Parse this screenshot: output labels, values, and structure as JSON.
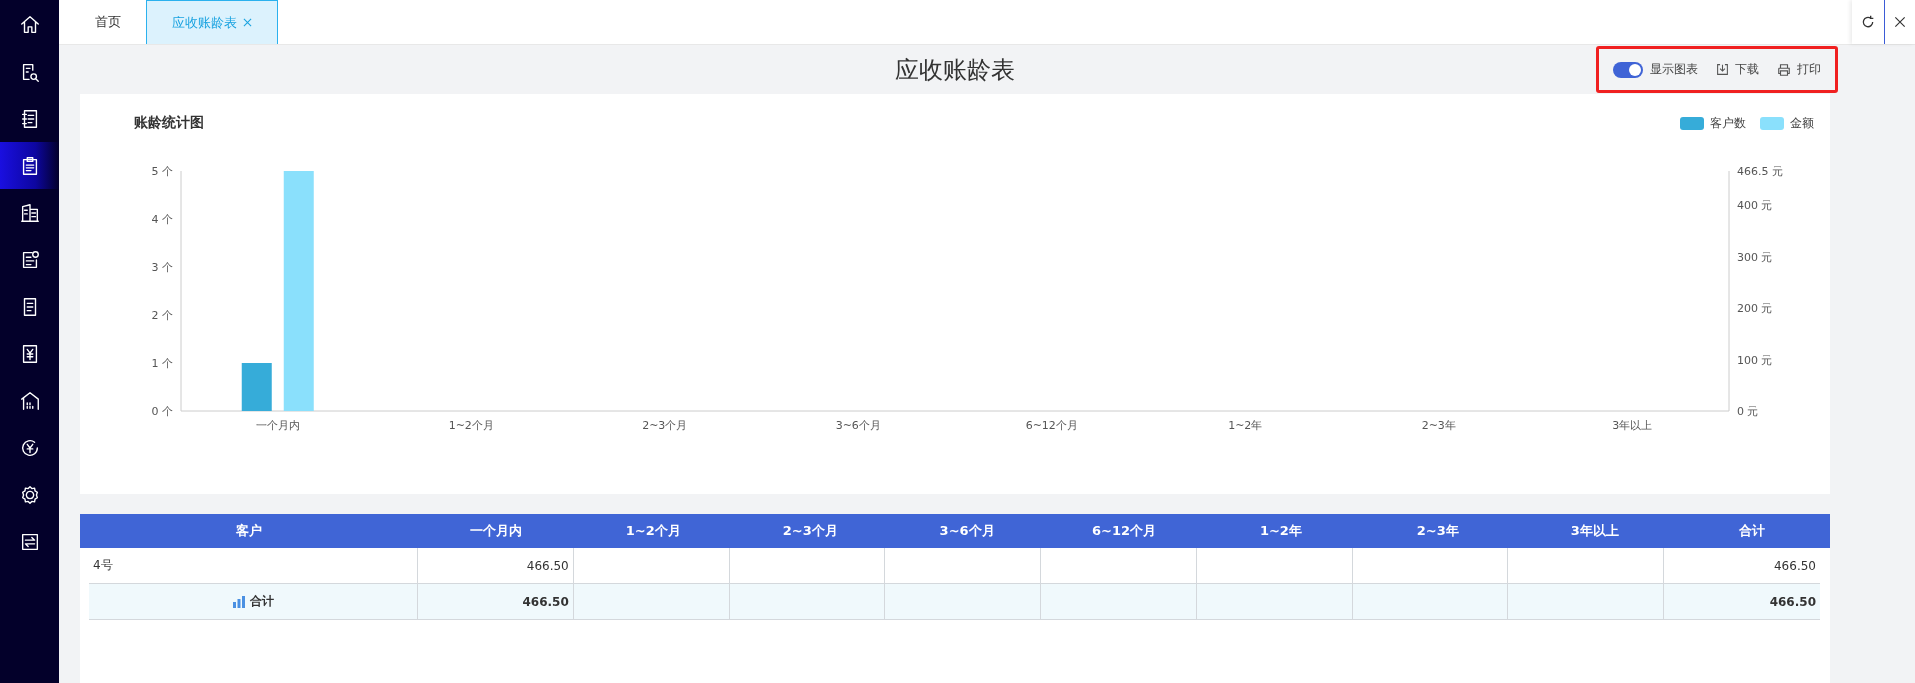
{
  "sidebar": {
    "items": [
      {
        "kind": "home",
        "selected": false
      },
      {
        "kind": "doc-search",
        "selected": false
      },
      {
        "kind": "notebook",
        "selected": false
      },
      {
        "kind": "clipboard",
        "selected": true
      },
      {
        "kind": "building",
        "selected": false
      },
      {
        "kind": "doc-yen",
        "selected": false
      },
      {
        "kind": "doc",
        "selected": false
      },
      {
        "kind": "yen",
        "selected": false
      },
      {
        "kind": "warehouse",
        "selected": false
      },
      {
        "kind": "yen-circle",
        "selected": false
      },
      {
        "kind": "gear",
        "selected": false
      },
      {
        "kind": "transfer",
        "selected": false
      }
    ]
  },
  "tabs": [
    {
      "label": "首页",
      "selected": false,
      "closable": false
    },
    {
      "label": "应收账龄表",
      "selected": true,
      "closable": true
    }
  ],
  "page": {
    "title": "应收账龄表"
  },
  "toolbar": {
    "highlighted": true,
    "toggle": {
      "label": "显示图表",
      "on": true
    },
    "buttons": [
      {
        "kind": "download",
        "label": "下载"
      },
      {
        "kind": "print",
        "label": "打印"
      }
    ]
  },
  "chart": {
    "title": "账龄统计图",
    "chart_data": {
      "type": "bar",
      "categories": [
        "一个月内",
        "1~2个月",
        "2~3个月",
        "3~6个月",
        "6~12个月",
        "1~2年",
        "2~3年",
        "3年以上"
      ],
      "series": [
        {
          "name": "客户数",
          "color": "#36acd9",
          "values": [
            1,
            0,
            0,
            0,
            0,
            0,
            0,
            0
          ]
        },
        {
          "name": "金额",
          "color": "#8ae0fc",
          "axis": "y2",
          "values": [
            466.5,
            0,
            0,
            0,
            0,
            0,
            0,
            0
          ]
        }
      ],
      "ylim": [
        0,
        5
      ],
      "yticks": [
        {
          "value": 0,
          "label": "0 个"
        },
        {
          "value": 1,
          "label": "1 个"
        },
        {
          "value": 2,
          "label": "2 个"
        },
        {
          "value": 3,
          "label": "3 个"
        },
        {
          "value": 4,
          "label": "4 个"
        },
        {
          "value": 5,
          "label": "5 个"
        }
      ],
      "y2lim": [
        0,
        466.5
      ],
      "y2ticks": [
        {
          "value": 0,
          "label": "0 元"
        },
        {
          "value": 100,
          "label": "100 元"
        },
        {
          "value": 200,
          "label": "200 元"
        },
        {
          "value": 300,
          "label": "300 元"
        },
        {
          "value": 400,
          "label": "400 元"
        },
        {
          "value": 466.5,
          "label": "466.5 元"
        }
      ]
    }
  },
  "table": {
    "columns": [
      "客户",
      "一个月内",
      "1~2个月",
      "2~3个月",
      "3~6个月",
      "6~12个月",
      "1~2年",
      "2~3年",
      "3年以上",
      "合计"
    ],
    "rows": [
      {
        "kind": "data",
        "cells": [
          "4号",
          "466.50",
          null,
          null,
          null,
          null,
          null,
          null,
          null,
          "466.50"
        ]
      },
      {
        "kind": "total",
        "cells": [
          "合计",
          "466.50",
          null,
          null,
          null,
          null,
          null,
          null,
          null,
          "466.50"
        ]
      }
    ]
  }
}
